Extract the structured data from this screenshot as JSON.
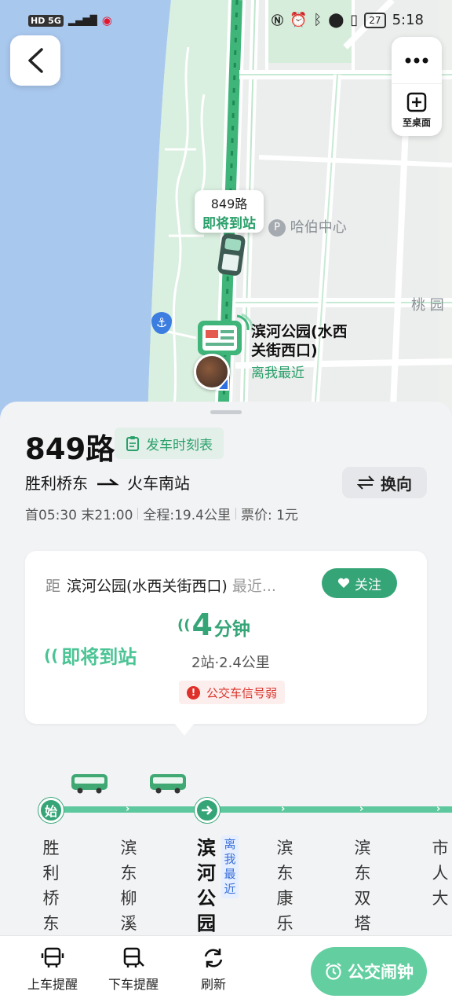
{
  "status_bar": {
    "left": "HD 5G",
    "battery": "27",
    "time": "5:18"
  },
  "map": {
    "poi_harbor": "哈伯中心",
    "poi_taoyuan": "桃 园",
    "bus_bubble": {
      "line": "849路",
      "status": "即将到站"
    },
    "stop_label": {
      "name_line1": "滨河公园(水西",
      "name_line2": "关街西口)",
      "tag": "离我最近"
    },
    "to_desktop_label": "至桌面"
  },
  "line": {
    "name": "849路",
    "timetable_label": "发车时刻表",
    "from": "胜利桥东",
    "to": "火车南站",
    "switch_label": "换向",
    "first_last": "首05:30 末21:00",
    "total_length": "全程:19.4公里",
    "fare": "票价: 1元"
  },
  "arrival_card": {
    "prefix": "距",
    "stop": "滨河公园(水西关街西口)",
    "suffix": "最近...",
    "follow_label": "关注",
    "arriving_label": "即将到站",
    "eta_value": "4",
    "eta_unit": "分钟",
    "stops_distance": "2站·2.4公里",
    "signal_warning": "公交车信号弱"
  },
  "route": {
    "start_badge": "始",
    "near_tag": "离我最近",
    "stops": [
      {
        "name": "胜利桥东"
      },
      {
        "name": "滨东柳溪"
      },
      {
        "name": "滨河公园"
      },
      {
        "name": "滨东康乐"
      },
      {
        "name": "滨东双塔"
      },
      {
        "name": "市人大"
      }
    ]
  },
  "bottom_bar": {
    "board_reminder": "上车提醒",
    "alight_reminder": "下车提醒",
    "refresh": "刷新",
    "alarm": "公交闹钟"
  }
}
